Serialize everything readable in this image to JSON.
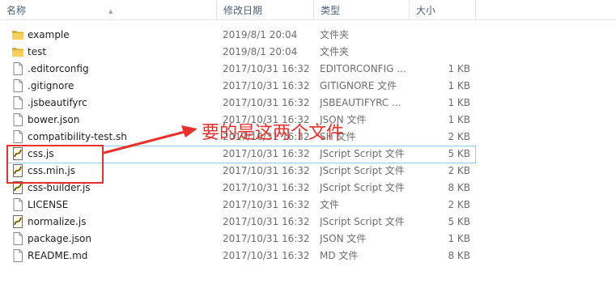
{
  "header": {
    "name_label": "名称",
    "date_label": "修改日期",
    "type_label": "类型",
    "size_label": "大小"
  },
  "files": [
    {
      "name": "example",
      "date": "2019/8/1 20:04",
      "type": "文件夹",
      "size": "",
      "icon": "folder-icon"
    },
    {
      "name": "test",
      "date": "2019/8/1 20:04",
      "type": "文件夹",
      "size": "",
      "icon": "folder-icon"
    },
    {
      "name": ".editorconfig",
      "date": "2017/10/31 16:32",
      "type": "EDITORCONFIG ...",
      "size": "1 KB",
      "icon": "file-icon"
    },
    {
      "name": ".gitignore",
      "date": "2017/10/31 16:32",
      "type": "GITIGNORE 文件",
      "size": "1 KB",
      "icon": "file-icon"
    },
    {
      "name": ".jsbeautifyrc",
      "date": "2017/10/31 16:32",
      "type": "JSBEAUTIFYRC ...",
      "size": "1 KB",
      "icon": "file-icon"
    },
    {
      "name": "bower.json",
      "date": "2017/10/31 16:32",
      "type": "JSON 文件",
      "size": "1 KB",
      "icon": "file-icon"
    },
    {
      "name": "compatibility-test.sh",
      "date": "2017/10/31 16:32",
      "type": "SH 文件",
      "size": "2 KB",
      "icon": "file-icon"
    },
    {
      "name": "css.js",
      "date": "2017/10/31 16:32",
      "type": "JScript Script 文件",
      "size": "5 KB",
      "icon": "script-icon"
    },
    {
      "name": "css.min.js",
      "date": "2017/10/31 16:32",
      "type": "JScript Script 文件",
      "size": "2 KB",
      "icon": "script-icon"
    },
    {
      "name": "css-builder.js",
      "date": "2017/10/31 16:32",
      "type": "JScript Script 文件",
      "size": "8 KB",
      "icon": "script-icon"
    },
    {
      "name": "LICENSE",
      "date": "2017/10/31 16:32",
      "type": "文件",
      "size": "2 KB",
      "icon": "file-icon"
    },
    {
      "name": "normalize.js",
      "date": "2017/10/31 16:32",
      "type": "JScript Script 文件",
      "size": "5 KB",
      "icon": "script-icon"
    },
    {
      "name": "package.json",
      "date": "2017/10/31 16:32",
      "type": "JSON 文件",
      "size": "1 KB",
      "icon": "file-icon"
    },
    {
      "name": "README.md",
      "date": "2017/10/31 16:32",
      "type": "MD 文件",
      "size": "8 KB",
      "icon": "file-icon"
    }
  ],
  "annotation": {
    "text": "要的是这两个文件",
    "color": "#e8302c"
  },
  "colors": {
    "folder": "#f0c24a",
    "header_text": "#4c607a",
    "highlight_border": "#99c8e8"
  }
}
